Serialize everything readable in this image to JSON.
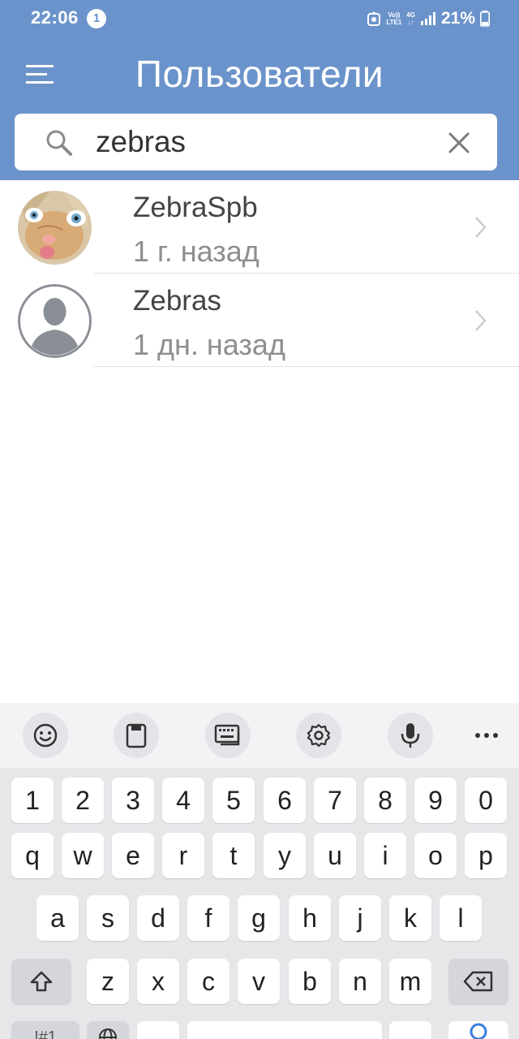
{
  "status_bar": {
    "time": "22:06",
    "notification_count": "1",
    "volte_label": "Vo))",
    "lte_label": "LTE1",
    "network_label": "4G",
    "battery_percent": "21%"
  },
  "header": {
    "title": "Пользователи",
    "menu_icon": "hamburger-menu-icon"
  },
  "search": {
    "value": "zebras",
    "placeholder": ""
  },
  "users": [
    {
      "name": "ZebraSpb",
      "last_seen": "1 г. назад",
      "avatar": "cat-photo"
    },
    {
      "name": "Zebras",
      "last_seen": "1 дн. назад",
      "avatar": "default-silhouette"
    }
  ],
  "keyboard": {
    "toolbar_icons": [
      "emoji-icon",
      "clipboard-icon",
      "keyboard-icon",
      "settings-icon",
      "microphone-icon",
      "more-icon"
    ],
    "row_numbers": [
      "1",
      "2",
      "3",
      "4",
      "5",
      "6",
      "7",
      "8",
      "9",
      "0"
    ],
    "row_top": [
      "q",
      "w",
      "e",
      "r",
      "t",
      "y",
      "u",
      "i",
      "o",
      "p"
    ],
    "row_middle": [
      "a",
      "s",
      "d",
      "f",
      "g",
      "h",
      "j",
      "k",
      "l"
    ],
    "row_bottom": [
      "z",
      "x",
      "c",
      "v",
      "b",
      "n",
      "m"
    ],
    "bottom_partial_left": "!#1"
  },
  "colors": {
    "header_bg": "#6b93cb",
    "text_primary": "#444444",
    "text_secondary": "#8e8e8e",
    "keyboard_bg": "#e7e7ea",
    "accent_blue": "#3d7fe0"
  }
}
